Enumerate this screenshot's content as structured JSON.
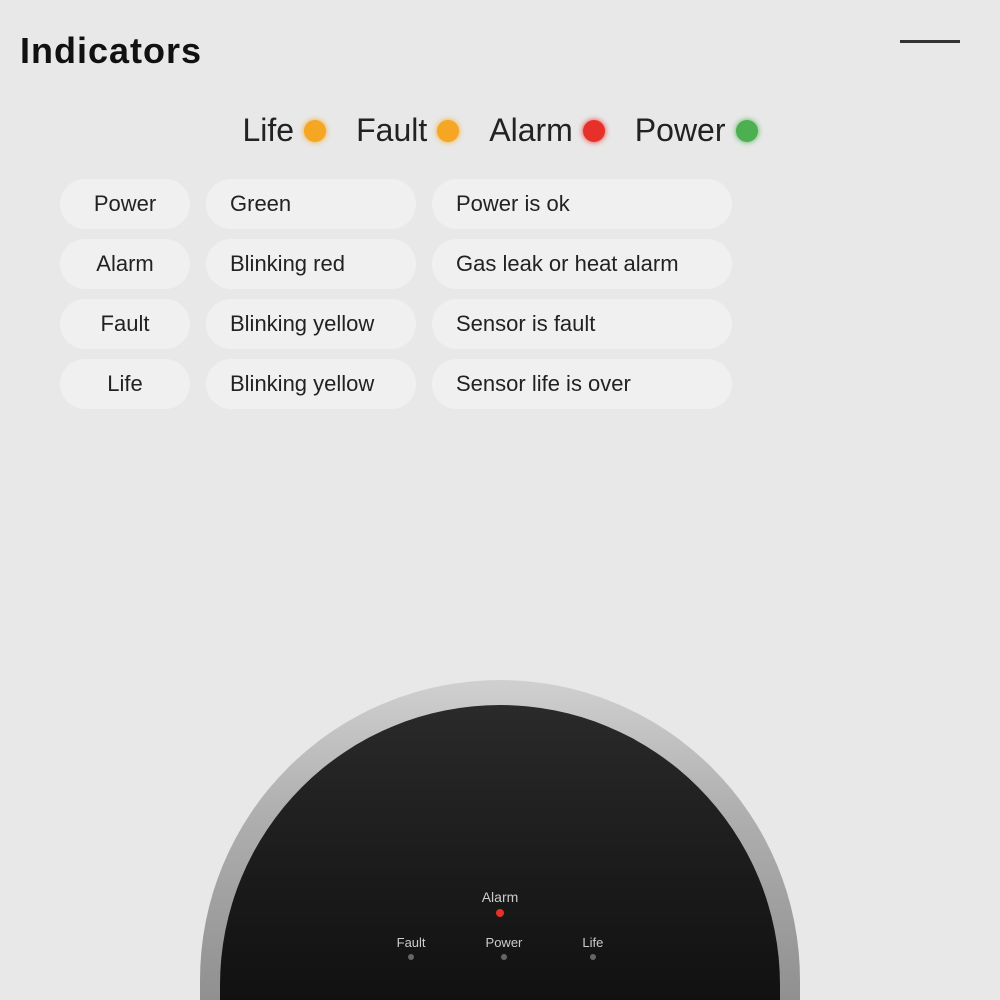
{
  "header": {
    "title": "Indicators",
    "line": true
  },
  "indicators": [
    {
      "label": "Life",
      "color": "yellow",
      "colorHex": "#f5a623"
    },
    {
      "label": "Fault",
      "color": "yellow",
      "colorHex": "#f5a623"
    },
    {
      "label": "Alarm",
      "color": "red",
      "colorHex": "#e8302a"
    },
    {
      "label": "Power",
      "color": "green",
      "colorHex": "#4caf50"
    }
  ],
  "table": {
    "rows": [
      {
        "col1": "Power",
        "col2": "Green",
        "col3": "Power is ok"
      },
      {
        "col1": "Alarm",
        "col2": "Blinking red",
        "col3": "Gas leak or heat alarm"
      },
      {
        "col1": "Fault",
        "col2": "Blinking yellow",
        "col3": "Sensor is fault"
      },
      {
        "col1": "Life",
        "col2": "Blinking yellow",
        "col3": "Sensor life is over"
      }
    ]
  },
  "device": {
    "alarm_label": "Alarm",
    "fault_label": "Fault",
    "power_label": "Power",
    "life_label": "Life"
  }
}
